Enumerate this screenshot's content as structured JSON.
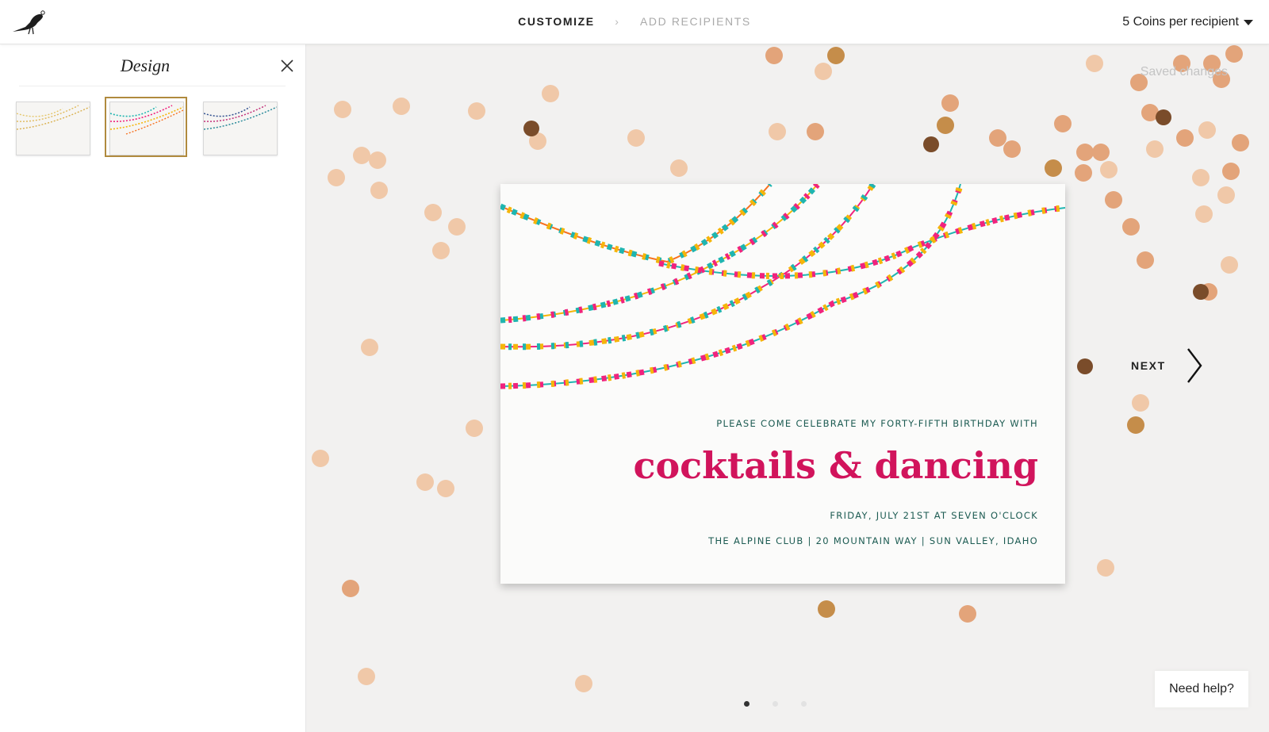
{
  "header": {
    "steps": [
      {
        "label": "CUSTOMIZE",
        "active": true
      },
      {
        "label": "ADD RECIPIENTS",
        "active": false
      }
    ],
    "step_separator": "›",
    "coins_label": "5 Coins per recipient",
    "icons": {
      "logo": "bird-logo-icon",
      "dropdown": "caret-down-icon"
    }
  },
  "sidebar": {
    "title": "Design",
    "close_icon": "close-icon",
    "thumbnails": [
      {
        "variant": "gold",
        "selected": false
      },
      {
        "variant": "multicolor",
        "selected": true
      },
      {
        "variant": "blue-pink",
        "selected": false
      }
    ]
  },
  "stage": {
    "status": "Saved changes",
    "next_label": "NEXT",
    "next_icon": "chevron-right-icon",
    "help_label": "Need help?",
    "pagination": {
      "count": 3,
      "current": 1
    }
  },
  "card": {
    "intro": "PLEASE COME CELEBRATE MY FORTY-FIFTH BIRTHDAY WITH",
    "headline": "cocktails & dancing",
    "date": "FRIDAY, JULY 21ST AT SEVEN O'CLOCK",
    "location": "THE ALPINE CLUB | 20 MOUNTAIN WAY | SUN VALLEY, IDAHO"
  },
  "colors": {
    "accent_gold": "#b08a3e",
    "headline_pink": "#d1145c",
    "body_teal": "#1c5b52",
    "garland_teal": "#1fb5b0",
    "garland_yellow": "#f5b50a",
    "garland_pink": "#f0237d",
    "garland_orange": "#f7711f",
    "confetti_copper": "#e7a77c"
  }
}
